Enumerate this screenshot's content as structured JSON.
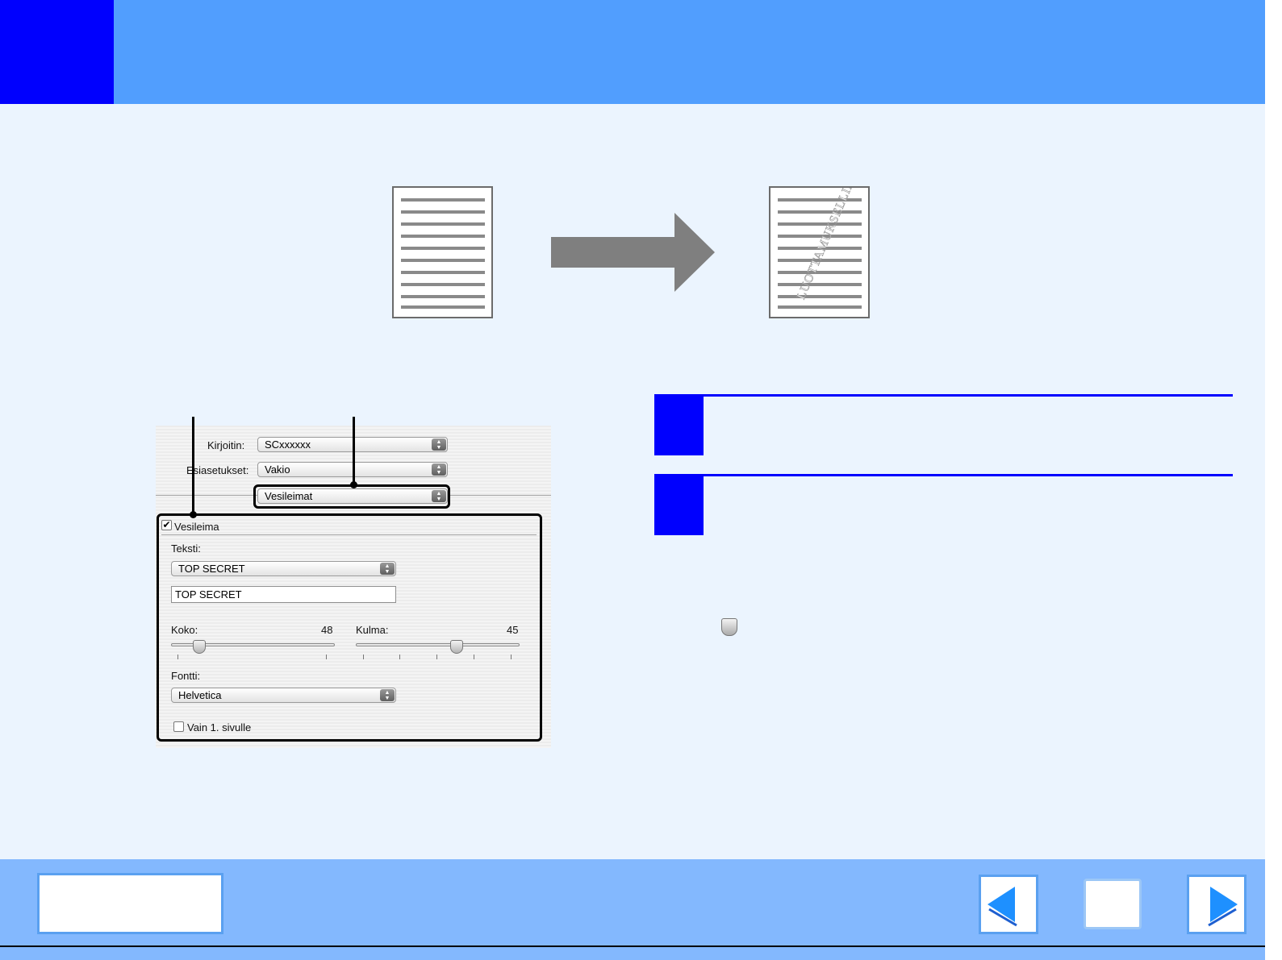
{
  "header": {
    "accent_color": "#0000fe",
    "bar_color": "#519efe"
  },
  "illustration": {
    "watermark_text": "LUOTTAMUKSELLINEN",
    "arrow_icon": "right-arrow-icon"
  },
  "dialog": {
    "printer_label": "Kirjoitin:",
    "printer_value": "SCxxxxxx",
    "presets_label": "Esiasetukset:",
    "presets_value": "Vakio",
    "panel_value": "Vesileimat",
    "watermark_checkbox_label": "Vesileima",
    "watermark_checked": true,
    "text_label": "Teksti:",
    "text_select_value": "TOP SECRET",
    "text_field_value": "TOP SECRET",
    "size_label": "Koko:",
    "size_value": "48",
    "angle_label": "Kulma:",
    "angle_value": "45",
    "font_label": "Fontti:",
    "font_value": "Helvetica",
    "first_page_label": "Vain 1. sivulle",
    "first_page_checked": false
  },
  "footer": {
    "contents_icon": "contents-button",
    "prev_icon": "left-arrow-icon",
    "home_icon": "square-icon",
    "next_icon": "right-arrow-icon"
  }
}
